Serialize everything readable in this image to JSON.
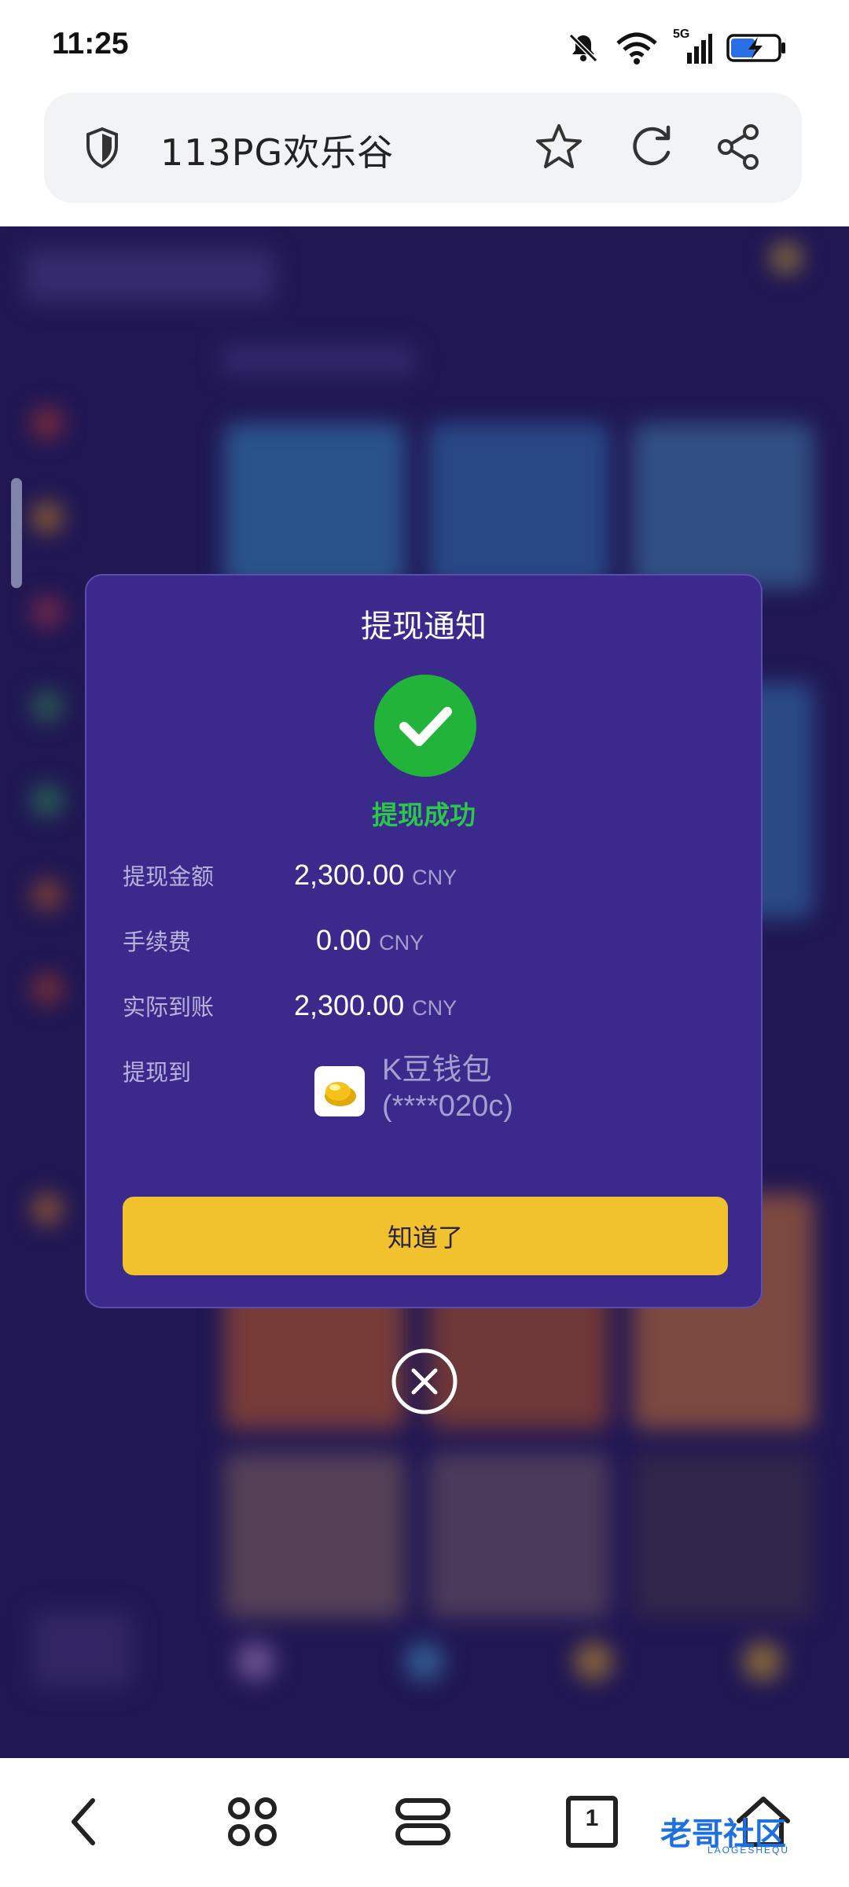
{
  "status_bar": {
    "time": "11:25",
    "network_label": "5G",
    "icons": [
      "bell-muted-icon",
      "wifi-icon",
      "signal-icon",
      "battery-charging-icon"
    ]
  },
  "browser": {
    "page_title": "113PG欢乐谷",
    "icons": [
      "shield-icon",
      "star-icon",
      "reload-icon",
      "share-icon"
    ]
  },
  "dialog": {
    "title": "提现通知",
    "status_text": "提现成功",
    "rows": [
      {
        "label": "提现金额",
        "value": "2,300.00",
        "unit": "CNY"
      },
      {
        "label": "手续费",
        "value": "0.00",
        "unit": "CNY"
      },
      {
        "label": "实际到账",
        "value": "2,300.00",
        "unit": "CNY"
      }
    ],
    "destination_label": "提现到",
    "wallet_name": "K豆钱包",
    "wallet_account": "(****020c)",
    "confirm_button": "知道了",
    "colors": {
      "background": "#3b2a8c",
      "success": "#22b33a",
      "button": "#f2c12e"
    }
  },
  "bottom_nav": {
    "tab_count": "1",
    "icons": [
      "back-icon",
      "apps-icon",
      "menu-icon",
      "tabs-icon",
      "home-icon"
    ]
  },
  "watermark": {
    "text": "老哥社区",
    "subtext": "LAOGESHEQU"
  }
}
